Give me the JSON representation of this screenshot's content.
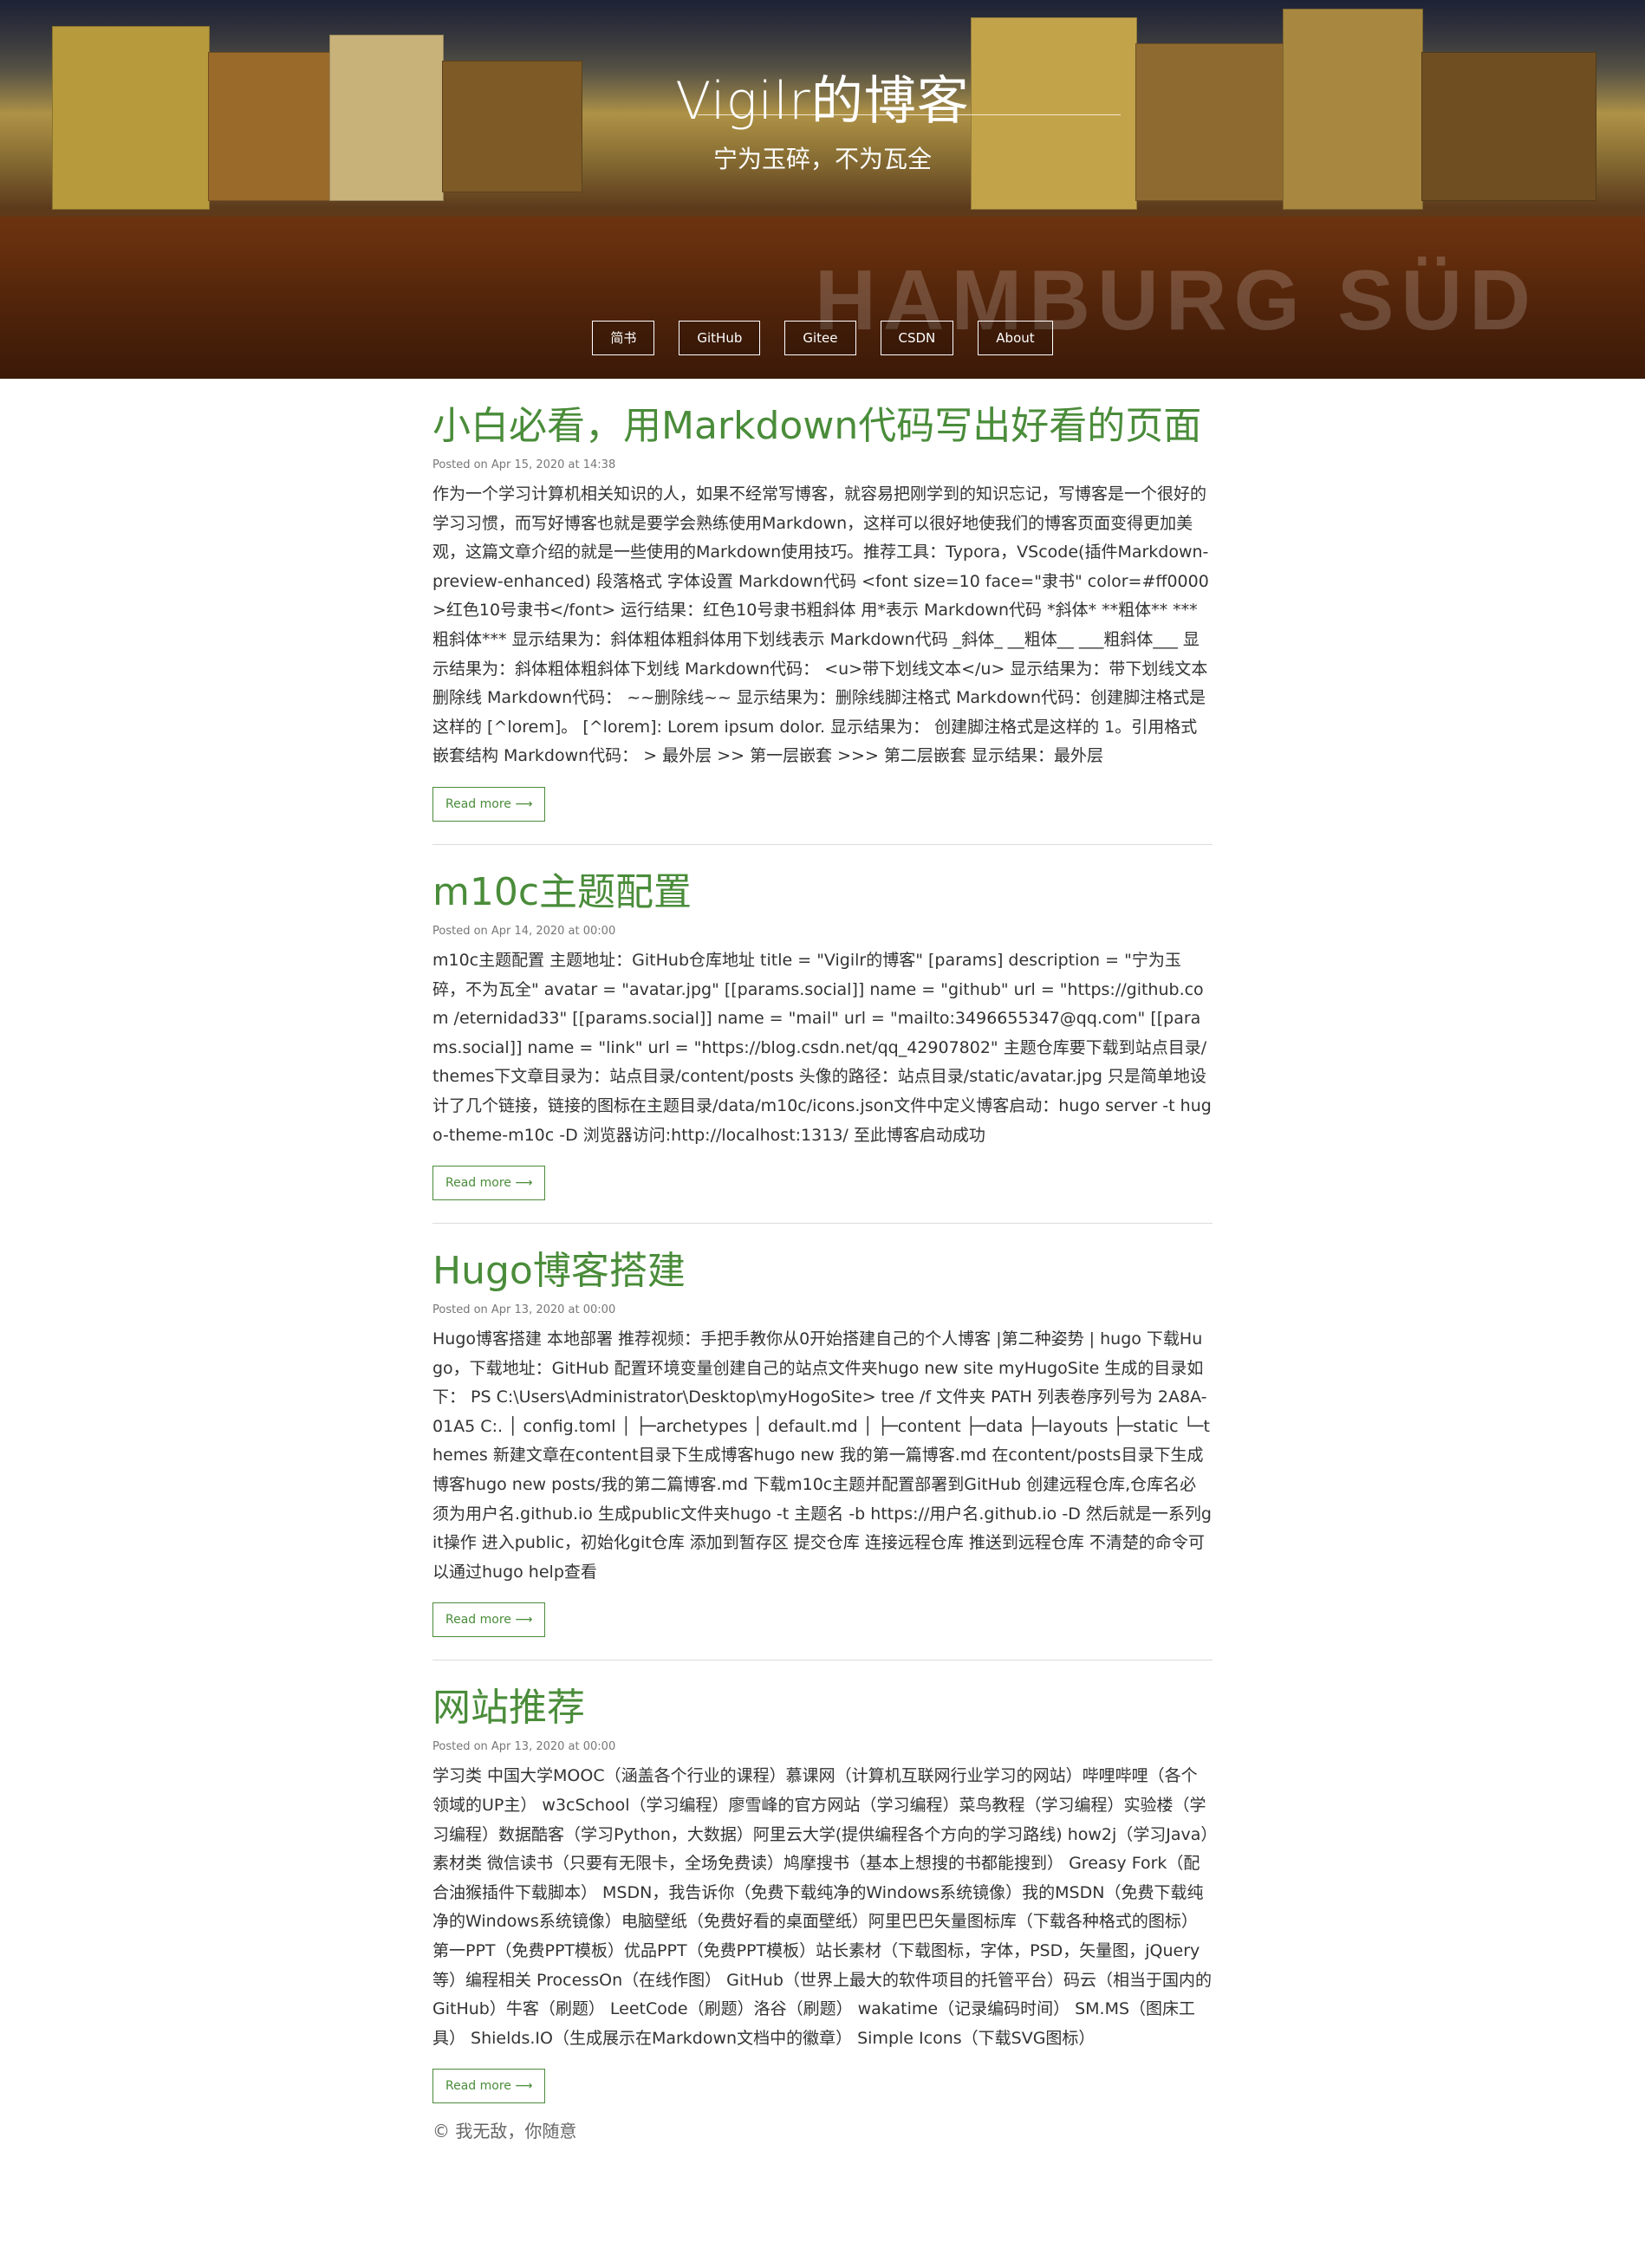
{
  "site": {
    "title": "Vigilr的博客",
    "subtitle": "宁为玉碎，不为瓦全",
    "background_text": "HAMBURG SÜD"
  },
  "nav": [
    {
      "label": "简书"
    },
    {
      "label": "GitHub"
    },
    {
      "label": "Gitee"
    },
    {
      "label": "CSDN"
    },
    {
      "label": "About"
    }
  ],
  "posts": [
    {
      "title": "小白必看，用Markdown代码写出好看的页面",
      "date": "Posted on Apr 15, 2020 at 14:38",
      "summary": "作为一个学习计算机相关知识的人，如果不经常写博客，就容易把刚学到的知识忘记，写博客是一个很好的学习习惯，而写好博客也就是要学会熟练使用Markdown，这样可以很好地使我们的博客页面变得更加美观，这篇文章介绍的就是一些使用的Markdown使用技巧。推荐工具：Typora，VScode(插件Markdown-preview-enhanced) 段落格式 字体设置 Markdown代码 <font size=10 face=\"隶书\" color=#ff0000>红色10号隶书</font> 运行结果：红色10号隶书粗斜体 用*表示 Markdown代码 *斜体* **粗体** ***粗斜体*** 显示结果为：斜体粗体粗斜体用下划线表示 Markdown代码 _斜体_ __粗体__ ___粗斜体___ 显示结果为：斜体粗体粗斜体下划线 Markdown代码： <u>带下划线文本</u> 显示结果为：带下划线文本 删除线 Markdown代码： ~~删除线~~ 显示结果为：删除线脚注格式 Markdown代码：创建脚注格式是这样的 [^lorem]。 [^lorem]: Lorem ipsum dolor. 显示结果为： 创建脚注格式是这样的 1。引用格式 嵌套结构 Markdown代码： > 最外层 >> 第一层嵌套 >>> 第二层嵌套 显示结果：最外层",
      "read_more": "Read more ⟶"
    },
    {
      "title": "m10c主题配置",
      "date": "Posted on Apr 14, 2020 at 00:00",
      "summary": "m10c主题配置 主题地址：GitHub仓库地址 title = \"Vigilr的博客\" [params] description = \"宁为玉碎，不为瓦全\" avatar = \"avatar.jpg\" [[params.social]] name = \"github\" url = \"https://github.com /eternidad33\" [[params.social]] name = \"mail\" url = \"mailto:3496655347@qq.com\" [[params.social]] name = \"link\" url = \"https://blog.csdn.net/qq_42907802\" 主题仓库要下载到站点目录/themes下文章目录为：站点目录/content/posts 头像的路径：站点目录/static/avatar.jpg 只是简单地设计了几个链接，链接的图标在主题目录/data/m10c/icons.json文件中定义博客启动：hugo server -t hugo-theme-m10c -D 浏览器访问:http://localhost:1313/ 至此博客启动成功",
      "read_more": "Read more ⟶"
    },
    {
      "title": "Hugo博客搭建",
      "date": "Posted on Apr 13, 2020 at 00:00",
      "summary": "Hugo博客搭建 本地部署 推荐视频：手把手教你从0开始搭建自己的个人博客 |第二种姿势 | hugo 下载Hugo，下载地址：GitHub 配置环境变量创建自己的站点文件夹hugo new site myHugoSite 生成的目录如下： PS C:\\Users\\Administrator\\Desktop\\myHogoSite> tree /f 文件夹 PATH 列表卷序列号为 2A8A-01A5 C:. │ config.toml │ ├─archetypes │ default.md │ ├─content ├─data ├─layouts ├─static └─themes 新建文章在content目录下生成博客hugo new 我的第一篇博客.md 在content/posts目录下生成博客hugo new posts/我的第二篇博客.md 下载m10c主题并配置部署到GitHub 创建远程仓库,仓库名必须为用户名.github.io 生成public文件夹hugo -t 主题名 -b https://用户名.github.io -D 然后就是一系列git操作 进入public，初始化git仓库 添加到暂存区 提交仓库 连接远程仓库 推送到远程仓库 不清楚的命令可以通过hugo help查看",
      "read_more": "Read more ⟶"
    },
    {
      "title": "网站推荐",
      "date": "Posted on Apr 13, 2020 at 00:00",
      "summary": "学习类 中国大学MOOC（涵盖各个行业的课程）慕课网（计算机互联网行业学习的网站）哔哩哔哩（各个领域的UP主） w3cSchool（学习编程）廖雪峰的官方网站（学习编程）菜鸟教程（学习编程）实验楼（学习编程）数据酷客（学习Python，大数据）阿里云大学(提供编程各个方向的学习路线) how2j（学习Java）素材类 微信读书（只要有无限卡，全场免费读）鸠摩搜书（基本上想搜的书都能搜到） Greasy Fork（配合油猴插件下载脚本） MSDN，我告诉你（免费下载纯净的Windows系统镜像）我的MSDN（免费下载纯净的Windows系统镜像）电脑壁纸（免费好看的桌面壁纸）阿里巴巴矢量图标库（下载各种格式的图标）第一PPT（免费PPT模板）优品PPT（免费PPT模板）站长素材（下载图标，字体，PSD，矢量图，jQuery等）编程相关 ProcessOn（在线作图） GitHub（世界上最大的软件项目的托管平台）码云（相当于国内的GitHub）牛客（刷题） LeetCode（刷题）洛谷（刷题） wakatime（记录编码时间） SM.MS（图床工具） Shields.IO（生成展示在Markdown文档中的徽章） Simple Icons（下载SVG图标）",
      "read_more": "Read more ⟶"
    }
  ],
  "footer": {
    "text": "© 我无敌，你随意"
  }
}
